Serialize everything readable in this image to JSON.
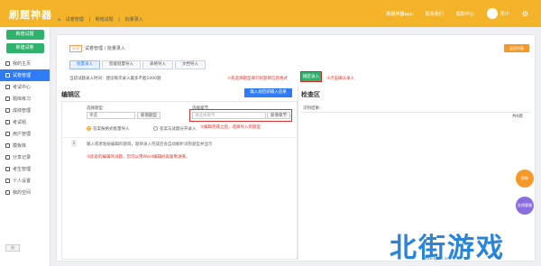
{
  "header": {
    "logo": "刷题神器",
    "links": [
      "刷题神器app",
      "联系我们",
      "帮助中心"
    ],
    "user": "张小"
  },
  "sidebar": {
    "buttons": [
      "新增试题",
      "新建试卷"
    ],
    "items": [
      "我的主页",
      "试卷管理",
      "考试中心",
      "题库练习",
      "成绩管理",
      "考试组",
      "用户管理",
      "模板库",
      "分享记录",
      "考生管理",
      "个人设置",
      "我的空间"
    ],
    "active_index": 1,
    "collapse_label": "收"
  },
  "breadcrumb": [
    "试卷管理",
    "新增试题",
    "批量录入"
  ],
  "main": {
    "tag": "必读",
    "subtitle": "试卷管理 / 批量录入",
    "top_right_button": "返回列表",
    "tabs": [
      "批量录入",
      "智能批量导入",
      "表格导入",
      "文档导入"
    ],
    "active_tab": 0,
    "note": "当前试题录入时间：建议每次录入最多不超1000题",
    "import_button": "确定录入",
    "annotation_red_1": "①先选择题型填写好题目信息格式",
    "annotation_red_2": "③点击确认录入",
    "annotation_red_3": "②编辑完成之后，选择导入的题型",
    "annotation_red_4": "③此处的编辑的试题，您可以用Word编辑好再复制进来。",
    "blue_button": "输入规范即输入后果",
    "edit_title": "编辑区",
    "check_title": "检查区",
    "fields": {
      "type_label": "选择题型",
      "type_value": "单选",
      "type_button": "新增题型",
      "section_label": "选择章节",
      "section_placeholder": "请选择章节",
      "section_button": "新增章节"
    },
    "radios": [
      "答案按格式批量导入",
      "答案与试题分开录入"
    ],
    "hint": "输入或者粘贴编辑的题目，题目录入完成后会自动解析试卷题型并显示",
    "row_number": "1",
    "check_label": "识别结果：",
    "check_right": "共0题"
  },
  "float_buttons": [
    "帮助",
    "在线客服",
    "返回"
  ],
  "watermark": {
    "text": "北街游戏",
    "sub": "www.bjhxs.net"
  }
}
